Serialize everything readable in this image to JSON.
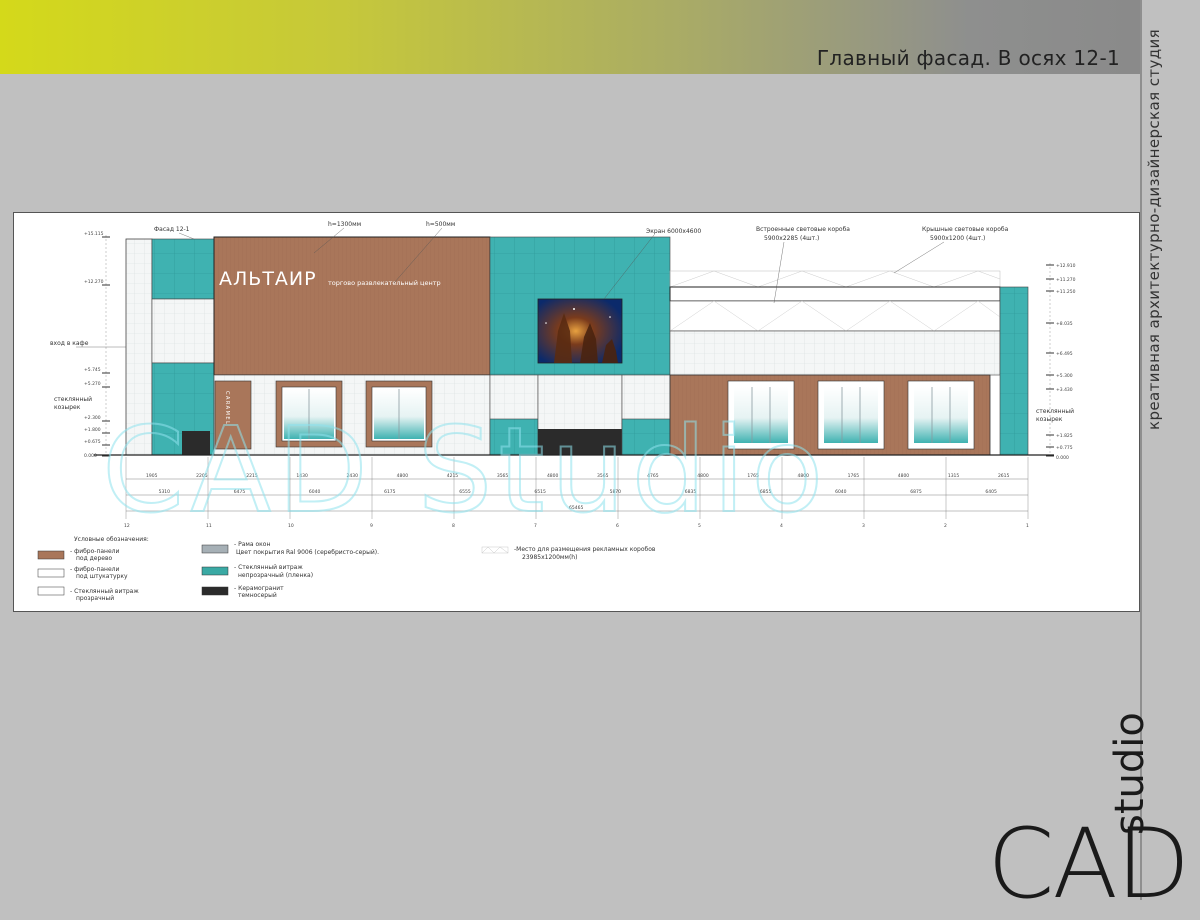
{
  "header": {
    "title": "Главный фасад. В осях 12-1"
  },
  "side_caption": "креативная архитектурно-дизайнерская студия",
  "brand": {
    "main": "CAD",
    "sub": "studio"
  },
  "watermark": "CAD Studio",
  "drawing": {
    "facade_label": "Фасад 12-1",
    "dim_h1": "h=1300мм",
    "dim_h2": "h=500мм",
    "screen_label": "Экран 6000х4600",
    "builtin_boxes_label": "Встроенные световые короба",
    "builtin_boxes_size": "5900х2285 (4шт.)",
    "roof_boxes_label": "Крышные световые короба",
    "roof_boxes_size": "5900х1200 (4шт.)",
    "sign_name": "АЛЬТАИР",
    "sign_sub": "торгово развлекательный центр",
    "cafe_sign": "CARAMEL",
    "cafe_entrance": "вход в кафе",
    "canopy_left_1": "стеклянный",
    "canopy_left_2": "козырек",
    "canopy_right_1": "стеклянный",
    "canopy_right_2": "козырек",
    "level_marks_left": [
      "+15.115",
      "+12.270",
      "+5.745",
      "+5.270",
      "+2.300",
      "+1.800",
      "+0.675",
      "0.000"
    ],
    "level_marks_right": [
      "+12.910",
      "+11.270",
      "+11.250",
      "+8.035",
      "+6.495",
      "+5.300",
      "+3.430",
      "+1.825",
      "+0.775",
      "0.000"
    ],
    "axis_labels": [
      "12",
      "11",
      "10",
      "9",
      "8",
      "7",
      "6",
      "5",
      "4",
      "3",
      "2",
      "1"
    ],
    "dims_row1": [
      "1905",
      "2205",
      "2215",
      "1430",
      "2430",
      "4800",
      "4215",
      "3565",
      "4800",
      "3565",
      "4765",
      "4800",
      "1765",
      "4800",
      "1765",
      "4800",
      "1315",
      "2615"
    ],
    "dims_row2": [
      "5310",
      "6475",
      "6040",
      "6175",
      "6555",
      "6515",
      "5870",
      "6835",
      "6855",
      "6040",
      "6875",
      "6405"
    ],
    "dims_total": "65465"
  },
  "legend": {
    "title": "Условные обозначения:",
    "items": [
      {
        "text1": "- фибро-панели",
        "text2": "под дерево",
        "color": "#a9765a"
      },
      {
        "text1": "- фибро-панели",
        "text2": "под штукатурку",
        "color": "#ffffff"
      },
      {
        "text1": "- Стеклянный витраж",
        "text2": "прозрачный",
        "color": "#ffffff"
      },
      {
        "text1": "- Рама окон",
        "text2": "Цвет покрытия  Ral 9006 (серебристо-серый).",
        "color": "#a6b0b6"
      },
      {
        "text1": "- Стеклянный витраж",
        "text2": "непрозрачный (пленка)",
        "color": "#3aa9a4"
      },
      {
        "text1": "- Керамогранит",
        "text2": "темносерый",
        "color": "#2b2b2b"
      },
      {
        "text1": "-Место для размещения рекламных коробов",
        "text2": "23985х1200мм(h)",
        "color": "#ffffff"
      }
    ]
  },
  "colors": {
    "wood": "#a9765a",
    "teal": "#3fb2b1",
    "teal_dark": "#2e9f9e",
    "granite": "#2b2b2b",
    "frame": "#a6b0b6"
  }
}
